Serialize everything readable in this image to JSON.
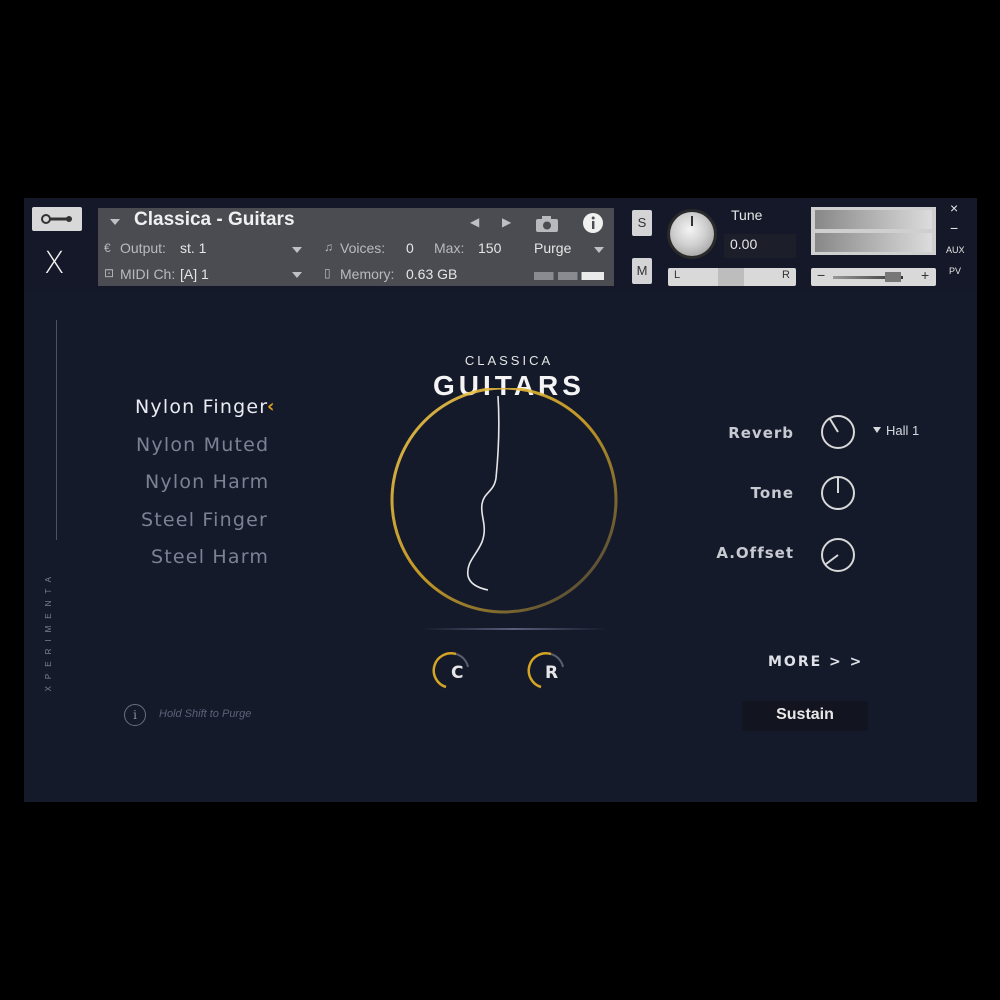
{
  "header": {
    "instrument_title": "Classica - Guitars",
    "output_label": "Output:",
    "output_value": "st. 1",
    "voices_label": "Voices:",
    "voices_value": "0",
    "max_label": "Max:",
    "max_value": "150",
    "purge_label": "Purge",
    "midi_label": "MIDI Ch:",
    "midi_value": "[A]  1",
    "memory_label": "Memory:",
    "memory_value": "0.63 GB",
    "solo_label": "S",
    "mute_label": "M",
    "tune_label": "Tune",
    "tune_value": "0.00",
    "pan_left": "L",
    "pan_right": "R",
    "vol_minus": "−",
    "vol_plus": "+",
    "aux_label": "AUX",
    "pv_label": "PV",
    "close_label": "×",
    "minimize_label": "−",
    "logo_letter": "X"
  },
  "sidebar": {
    "vertical_text": "XPERIMENTA"
  },
  "articulations": [
    {
      "label": "Nylon Finger",
      "selected": true
    },
    {
      "label": "Nylon Muted",
      "selected": false
    },
    {
      "label": "Nylon Harm",
      "selected": false
    },
    {
      "label": "Steel Finger",
      "selected": false
    },
    {
      "label": "Steel Harm",
      "selected": false
    }
  ],
  "brand": {
    "subtitle": "CLASSICA",
    "title": "GUITARS"
  },
  "center_knobs": {
    "left_label": "C",
    "right_label": "R"
  },
  "params": {
    "reverb_label": "Reverb",
    "reverb_type": "Hall 1",
    "tone_label": "Tone",
    "offset_label": "A.Offset"
  },
  "more_label": "MORE > >",
  "sustain_label": "Sustain",
  "hint": "Hold Shift to Purge",
  "colors": {
    "accent": "#e1a21a",
    "panel_bg": "#151a2b",
    "header_bg": "#4a4c52"
  }
}
